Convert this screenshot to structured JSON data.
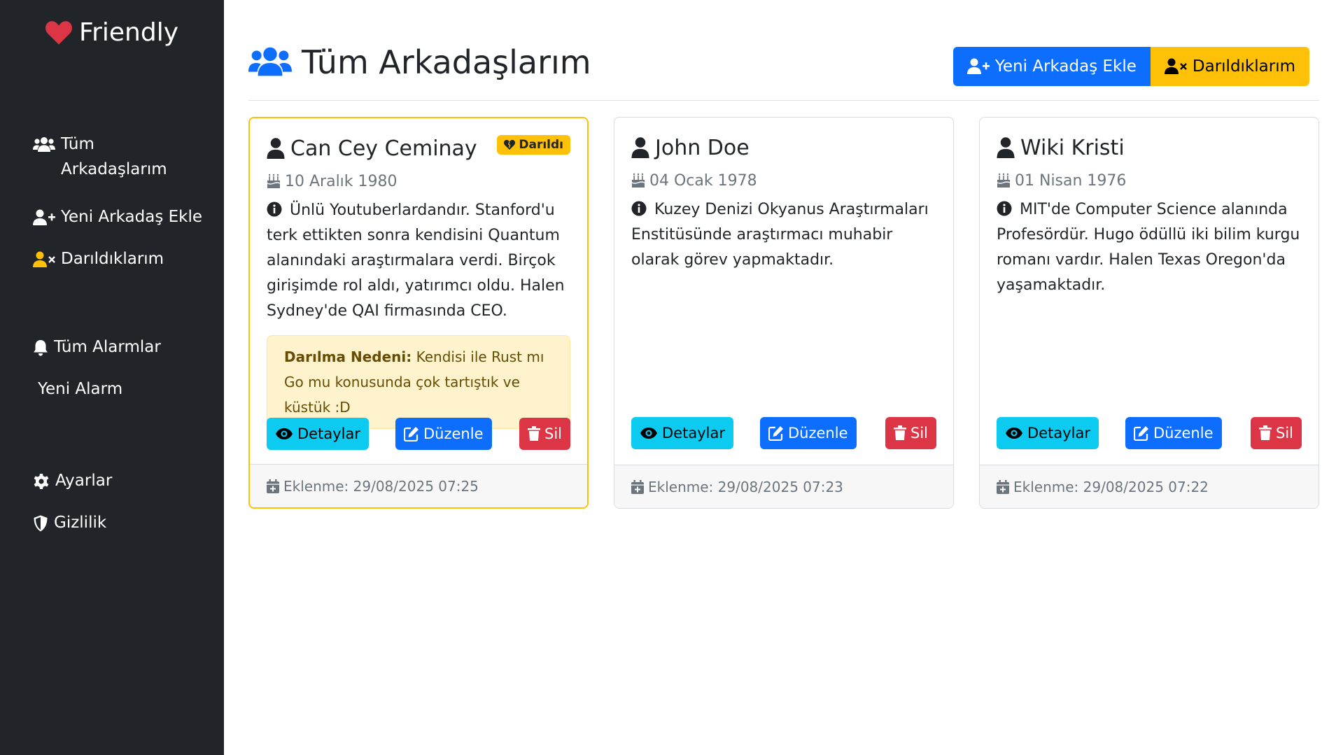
{
  "colors": {
    "sidebar_bg": "#212529",
    "primary": "#0d6efd",
    "warning": "#ffc107",
    "info": "#0dcaf0",
    "danger": "#dc3545",
    "heart": "#dc3545"
  },
  "sidebar": {
    "brand": "Friendly",
    "brand_icon": "heart-icon",
    "items": [
      {
        "label": "Tüm Arkadaşlarım",
        "icon": "users-icon"
      },
      {
        "label": "Yeni Arkadaş Ekle",
        "icon": "user-plus-icon"
      },
      {
        "label": "Darıldıklarım",
        "icon": "user-xmark-icon"
      },
      {
        "label": "Tüm Alarmlar",
        "icon": "bell-icon"
      },
      {
        "label": "Yeni Alarm",
        "icon": ""
      },
      {
        "label": "Ayarlar",
        "icon": "gear-icon"
      },
      {
        "label": "Gizlilik",
        "icon": "shield-icon"
      }
    ]
  },
  "header": {
    "title": "Tüm Arkadaşlarım",
    "add_button": "Yeni Arkadaş Ekle",
    "sulked_button": "Darıldıklarım"
  },
  "cards": [
    {
      "name": "Can Cey Ceminay",
      "badge": "Darıldı",
      "birthday": "10 Aralık 1980",
      "description": "Ünlü Youtuberlardandır. Stanford'u terk ettikten sonra kendisini Quantum alanındaki araştırmalara verdi. Birçok girişimde rol aldı, yatırımcı oldu. Halen Sydney'de QAI firmasında CEO.",
      "reason_label": "Darılma Nedeni:",
      "reason": "Kendisi ile Rust mı Go mu konusunda çok tartıştık ve küstük :D",
      "details": "Detaylar",
      "edit": "Düzenle",
      "delete": "Sil",
      "added": "Eklenme: 29/08/2025 07:25"
    },
    {
      "name": "John Doe",
      "birthday": "04 Ocak 1978",
      "description": "Kuzey Denizi Okyanus Araştırmaları Enstitüsünde araştırmacı muhabir olarak görev yapmaktadır.",
      "details": "Detaylar",
      "edit": "Düzenle",
      "delete": "Sil",
      "added": "Eklenme: 29/08/2025 07:23"
    },
    {
      "name": "Wiki Kristi",
      "birthday": "01 Nisan 1976",
      "description": "MIT'de Computer Science alanında Profesördür. Hugo ödüllü iki bilim kurgu romanı vardır. Halen Texas Oregon'da yaşamaktadır.",
      "details": "Detaylar",
      "edit": "Düzenle",
      "delete": "Sil",
      "added": "Eklenme: 29/08/2025 07:22"
    }
  ]
}
